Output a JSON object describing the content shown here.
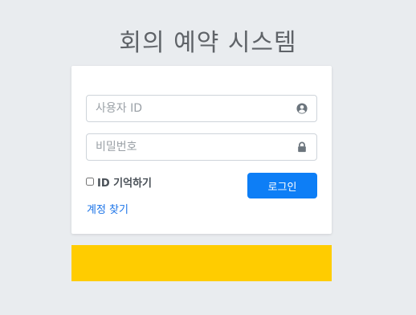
{
  "app": {
    "title": "회의 예약 시스템"
  },
  "login_form": {
    "user_id_placeholder": "사용자 ID",
    "password_placeholder": "비밀번호",
    "remember_label": "ID 기억하기",
    "login_button": "로그인",
    "find_account_link": "계정 찾기"
  },
  "icons": {
    "user": "user-circle-icon",
    "password": "lock-icon"
  },
  "colors": {
    "page_background": "#e9ecef",
    "primary_button": "#0d7ef6",
    "link": "#1a73e8",
    "notice_bar": "#ffcc00"
  }
}
